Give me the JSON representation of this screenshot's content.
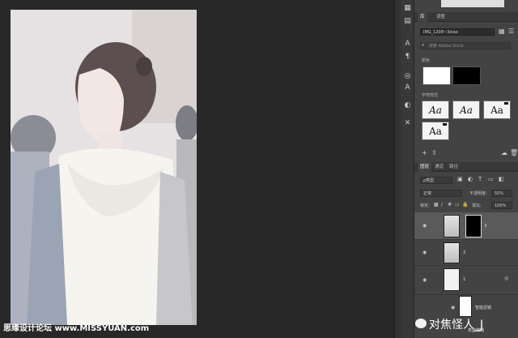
{
  "panel_tabs": {
    "library": "库",
    "adjust": "调整"
  },
  "library": {
    "dropdown": "IMG_1208~3xiao",
    "search_placeholder": "搜索 Adobe Stock",
    "colors_header": "颜色",
    "char_styles_header": "字符样式",
    "char_styles": [
      "Aa",
      "Aa",
      "Aa",
      "Aa"
    ],
    "colors": {
      "swatch_1": "#ffffff",
      "swatch_2": "#000000"
    }
  },
  "layers_panel": {
    "tabs": [
      "图层",
      "通道",
      "路径"
    ],
    "filter_kind": "ρ类型",
    "blend_mode": "正常",
    "opacity_label": "不透明度:",
    "opacity_value": "55%",
    "lock_label": "锁定:",
    "fill_label": "填充:",
    "fill_value": "100%",
    "layers": [
      {
        "name": "3",
        "selected": true,
        "has_mask": true
      },
      {
        "name": "2",
        "selected": false,
        "has_mask": false
      },
      {
        "name": "1",
        "selected": false,
        "has_mask": false
      }
    ],
    "smart_filter_label": "智能滤镜",
    "sub_filter_label": "表面模糊"
  },
  "watermarks": {
    "left": "思缘设计论坛 www.MISSYUAN.com",
    "right": "对焦怪人_J"
  }
}
